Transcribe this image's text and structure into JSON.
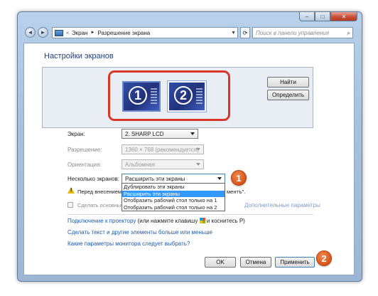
{
  "window": {
    "breadcrumb_root": "Экран",
    "breadcrumb_sep": "►",
    "breadcrumb_current": "Разрешение экрана",
    "search_placeholder": "Поиск в панели управления",
    "controls": {
      "minimize": "–",
      "maximize": "□",
      "close": "✕"
    }
  },
  "heading": "Настройки экранов",
  "monitors": [
    {
      "number": "1",
      "selected": false
    },
    {
      "number": "2",
      "selected": true
    }
  ],
  "buttons": {
    "find": "Найти",
    "identify": "Определить",
    "advanced": "Дополнительные параметры",
    "ok": "OK",
    "cancel": "Отмена",
    "apply": "Применить"
  },
  "fields": {
    "display_label": "Экран:",
    "display_value": "2. SHARP LCD",
    "resolution_label": "Разрешение:",
    "resolution_value": "1360 × 768 (рекомендуется)",
    "orientation_label": "Ориентация:",
    "orientation_value": "Альбомная",
    "multiple_label": "Несколько экранов:",
    "multiple_value": "Расширить эти экраны"
  },
  "multiple_options": [
    {
      "label": "Дублировать эти экраны",
      "highlighted": false
    },
    {
      "label": "Расширить эти экраны",
      "highlighted": true
    },
    {
      "label": "Отобразить рабочий стол только на 1",
      "highlighted": false
    },
    {
      "label": "Отобразить рабочий стол только на 2",
      "highlighted": false
    }
  ],
  "warning_text_left": "Перед внесением",
  "warning_text_right": "ментъ\".",
  "checkbox_label": "Сделать основным",
  "links": {
    "projector": "Подключение к проектору",
    "projector_hint": "(или нажмите клавишу",
    "projector_hint_end": "и коснитесь P)",
    "bigger_text": "Сделать текст и другие элементы больше или меньше",
    "monitor_params": "Какие параметры монитора следует выбрать?"
  },
  "badges": {
    "first": "1",
    "second": "2"
  },
  "colors": {
    "highlight": "#d9362a",
    "badge": "#e06524",
    "selection": "#3399ff"
  }
}
